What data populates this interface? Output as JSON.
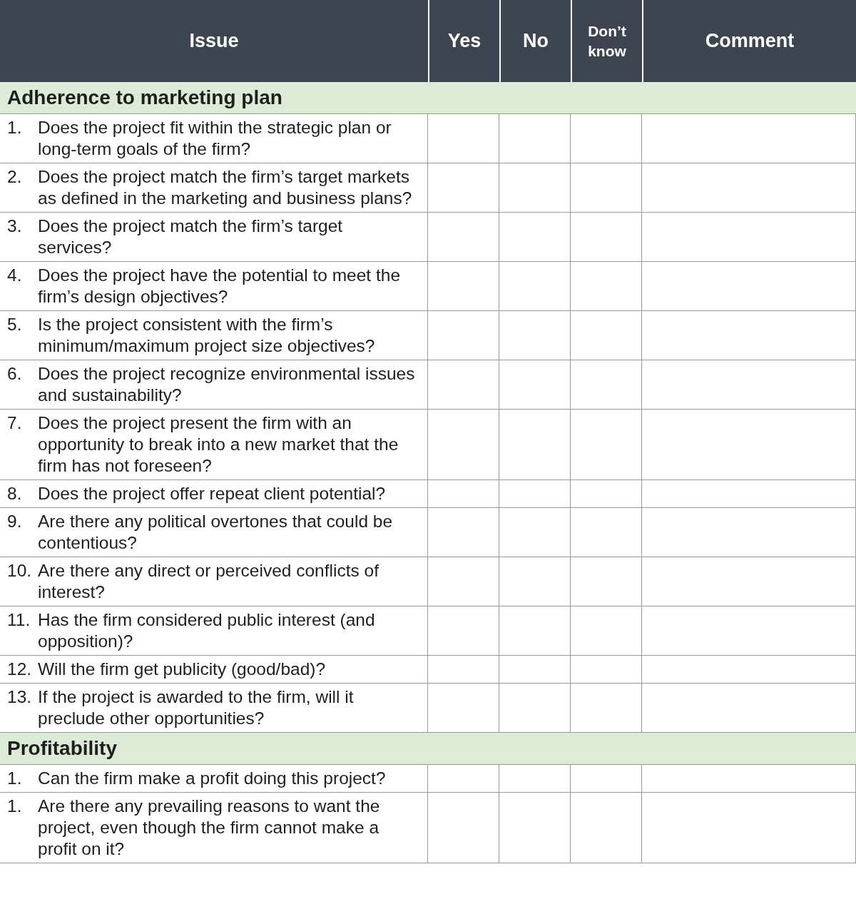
{
  "table": {
    "columns": [
      "Issue",
      "Yes",
      "No",
      "Don’t know",
      "Comment"
    ],
    "sections": [
      {
        "title": "Adherence to marketing plan",
        "questions": [
          {
            "number": "1.",
            "text": "Does the project fit within the strategic plan or long-term goals of the firm?"
          },
          {
            "number": "2.",
            "text": "Does the project match the firm’s target markets as defined in the marketing and business plans?"
          },
          {
            "number": "3.",
            "text": "Does the project match the firm’s target services?"
          },
          {
            "number": "4.",
            "text": "Does the project have the potential to meet the firm’s design objectives?"
          },
          {
            "number": "5.",
            "text": "Is the project consistent with the firm’s minimum/maximum project size objectives?"
          },
          {
            "number": "6.",
            "text": "Does the project recognize environmental issues and sustainability?"
          },
          {
            "number": "7.",
            "text": "Does the project present the firm with an opportunity to break into a new market that the firm has not foreseen?"
          },
          {
            "number": "8.",
            "text": "Does the project offer repeat client potential?"
          },
          {
            "number": "9.",
            "text": "Are there any political overtones that could be contentious?"
          },
          {
            "number": "10.",
            "text": "Are there any direct or perceived conflicts of interest?"
          },
          {
            "number": "11.",
            "text": "Has the firm considered public interest (and opposition)?"
          },
          {
            "number": "12.",
            "text": "Will the firm get publicity (good/bad)?"
          },
          {
            "number": "13.",
            "text": "If the project is awarded to the firm, will it preclude other opportunities?"
          }
        ]
      },
      {
        "title": "Profitability",
        "questions": [
          {
            "number": "1.",
            "text": "Can the firm make a profit doing this project?"
          },
          {
            "number": "1.",
            "text": "Are there any prevailing reasons to want the project, even though the firm cannot make a profit on it?"
          }
        ]
      }
    ]
  }
}
